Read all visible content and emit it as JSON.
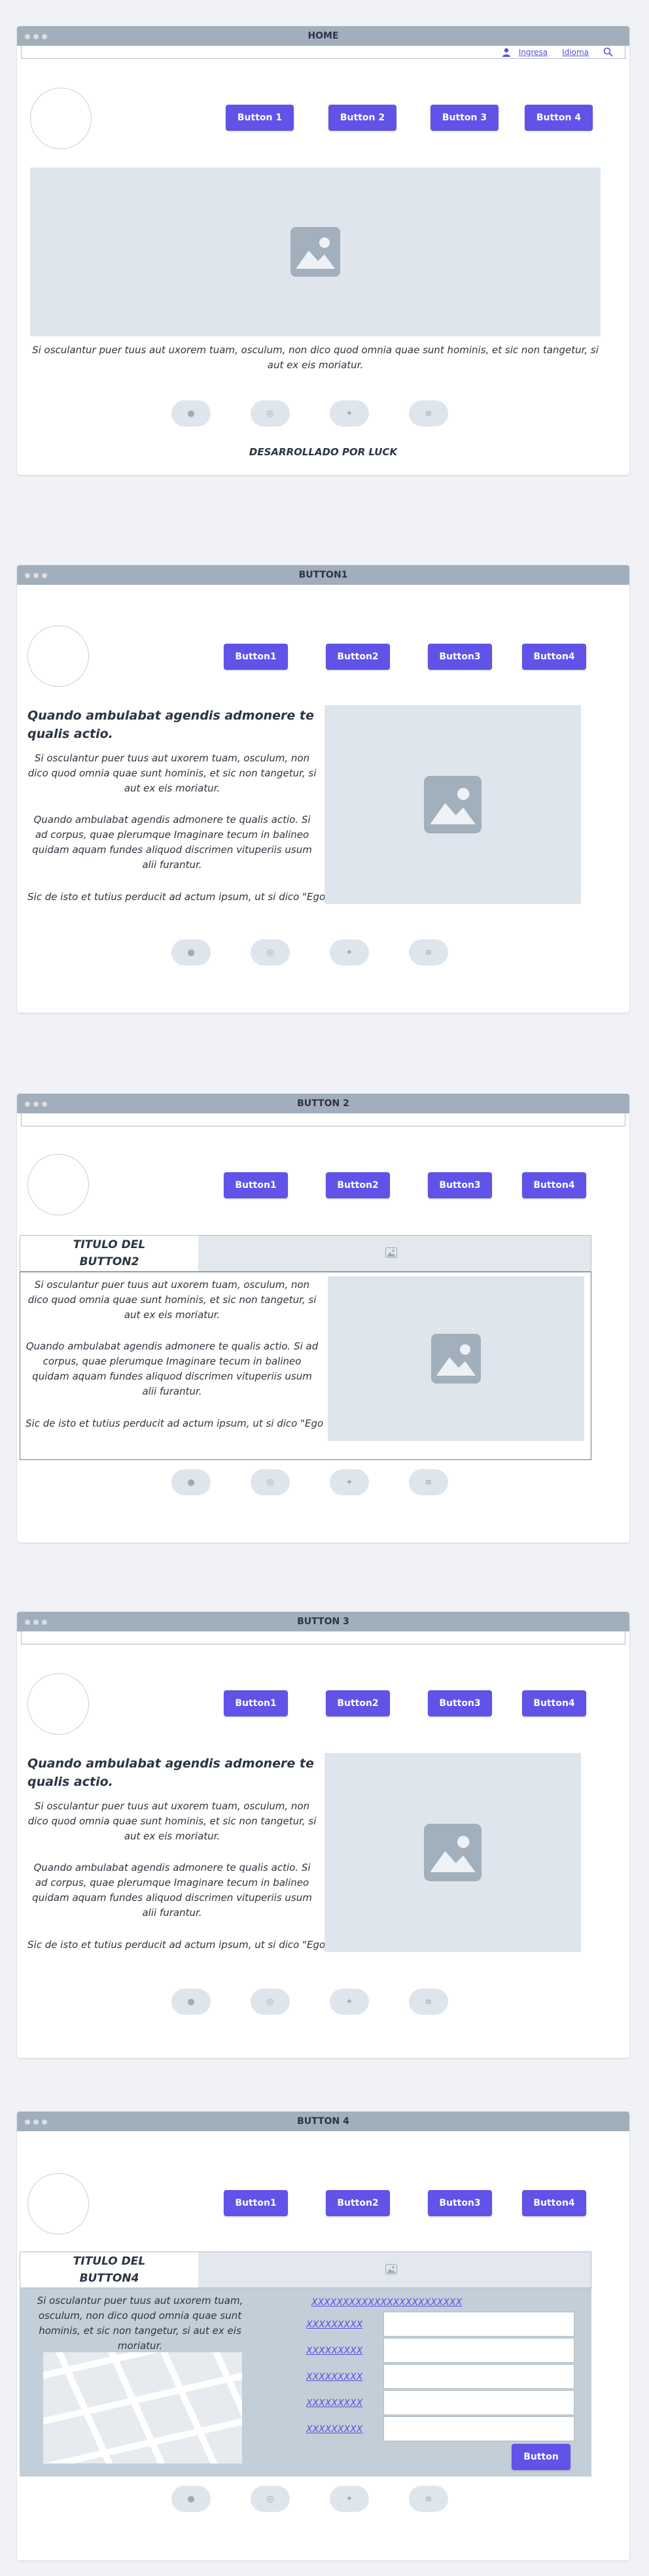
{
  "nav_buttons": [
    "Button 1",
    "Button 2",
    "Button 3",
    "Button 4"
  ],
  "nav_buttons_compact": [
    "Button1",
    "Button2",
    "Button3",
    "Button4"
  ],
  "social": [
    "facebook-icon",
    "instagram-icon",
    "twitter-icon",
    "spotify-icon"
  ],
  "colors": {
    "accent": "#6152e8",
    "titlebar": "#a0afbb",
    "placeholder": "#dfe5ec"
  },
  "home": {
    "title": "HOME",
    "login_link": "Ingresa",
    "language_link": "Idioma",
    "body_text": "Si osculantur puer tuus aut uxorem tuam, osculum, non dico quod omnia quae sunt hominis, et sic non tangetur, si aut ex eis moriatur.",
    "credit": "DESARROLLADO POR LUCK"
  },
  "button1": {
    "title": "BUTTON1",
    "heading": "Quando ambulabat agendis admonere te qualis actio.",
    "para1": "Si osculantur puer tuus aut uxorem tuam, osculum, non dico quod omnia quae sunt hominis, et sic non tangetur, si aut ex eis moriatur.",
    "para2": "Quando ambulabat agendis admonere te qualis actio. Si ad corpus, quae plerumque Imaginare tecum in balineo quidam aquam fundes aliquod discrimen vituperiis usum alii furantur.",
    "para3": "Sic de isto et tutius perducit ad actum ipsum, ut si dico \"Ego"
  },
  "button2": {
    "title": "BUTTON 2",
    "tab_title": "TITULO DEL BUTTON2",
    "para1": "Si osculantur puer tuus aut uxorem tuam, osculum, non dico quod omnia quae sunt hominis, et sic non tangetur, si aut ex eis moriatur.",
    "para2": "Quando ambulabat agendis admonere te qualis actio. Si ad corpus, quae plerumque Imaginare tecum in balineo quidam aquam fundes aliquod discrimen vituperiis usum alii furantur.",
    "para3": "Sic de isto et tutius perducit ad actum ipsum, ut si dico \"Ego"
  },
  "button3": {
    "title": "BUTTON 3",
    "heading": "Quando ambulabat agendis admonere te qualis actio.",
    "para1": "Si osculantur puer tuus aut uxorem tuam, osculum, non dico quod omnia quae sunt hominis, et sic non tangetur, si aut ex eis moriatur.",
    "para2": "Quando ambulabat agendis admonere te qualis actio. Si ad corpus, quae plerumque Imaginare tecum in balineo quidam aquam fundes aliquod discrimen vituperiis usum alii furantur.",
    "para3": "Sic de isto et tutius perducit ad actum ipsum, ut si dico \"Ego"
  },
  "button4": {
    "title": "BUTTON 4",
    "tab_title": "TITULO DEL BUTTON4",
    "para": "Si osculantur puer tuus aut uxorem tuam, osculum, non dico quod omnia quae sunt hominis, et sic non tangetur, si aut ex eis moriatur.",
    "form_heading": "XXXXXXXXXXXXXXXXXXXXXXXX",
    "field_labels": [
      "XXXXXXXXX",
      "XXXXXXXXX",
      "XXXXXXXXX",
      "XXXXXXXXX",
      "XXXXXXXXX"
    ],
    "submit": "Button"
  }
}
